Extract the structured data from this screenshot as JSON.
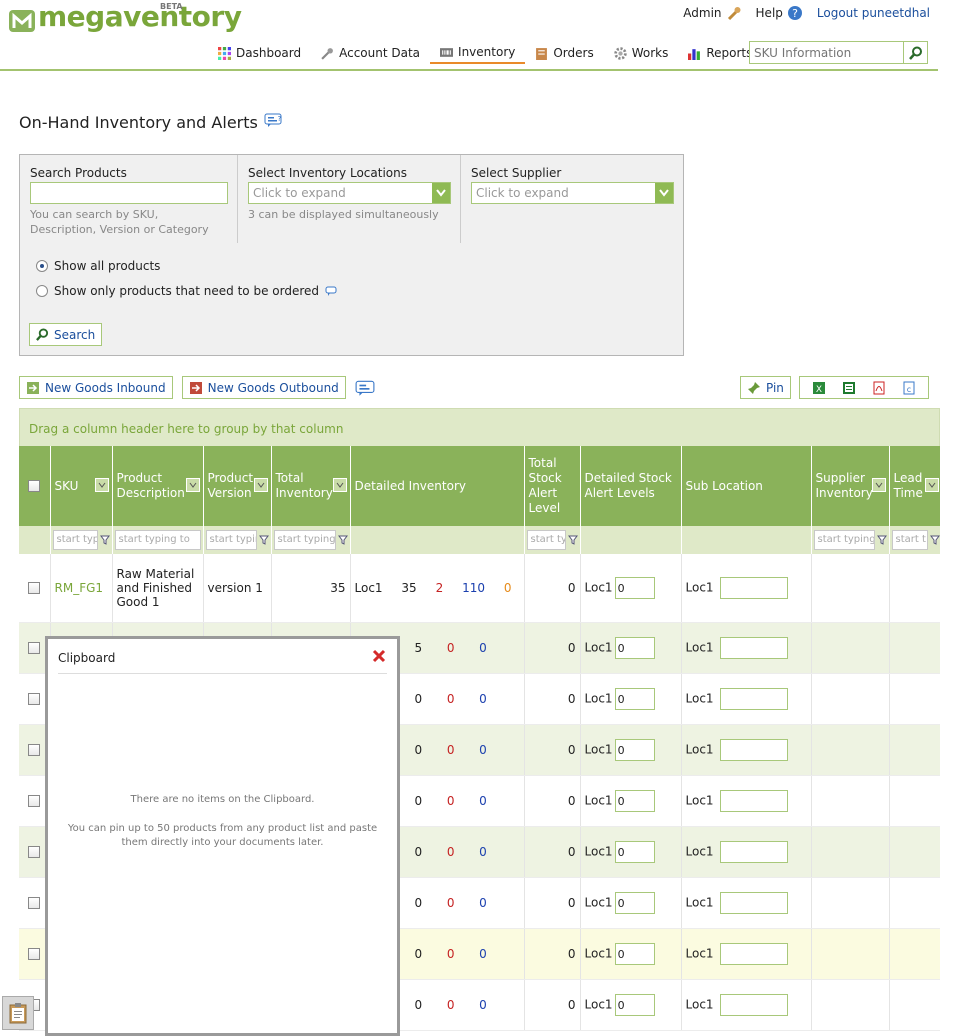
{
  "app": {
    "logo_text": "megaventory",
    "beta": "BETA",
    "user_links": {
      "admin": "Admin",
      "help": "Help",
      "logout": "Logout puneetdhal"
    },
    "nav": [
      {
        "label": "Dashboard",
        "icon": "dashboard-icon"
      },
      {
        "label": "Account Data",
        "icon": "wrench-icon"
      },
      {
        "label": "Inventory",
        "icon": "inventory-icon"
      },
      {
        "label": "Orders",
        "icon": "orders-icon"
      },
      {
        "label": "Works",
        "icon": "gear-icon"
      },
      {
        "label": "Reports",
        "icon": "chart-icon"
      }
    ],
    "sku_search_placeholder": "SKU Information",
    "accent": "#8ab25a"
  },
  "page": {
    "title": "On-Hand Inventory and Alerts"
  },
  "search_panel": {
    "products_label": "Search Products",
    "products_hint": "You can search by SKU, Description, Version or Category",
    "locations_label": "Select Inventory Locations",
    "locations_placeholder": "Click to expand",
    "locations_hint": "3 can be displayed simultaneously",
    "supplier_label": "Select Supplier",
    "supplier_placeholder": "Click to expand",
    "radio_all": "Show all products",
    "radio_need": "Show only products that need to be ordered",
    "search_button": "Search"
  },
  "toolbar": {
    "new_inbound": "New Goods Inbound",
    "new_outbound": "New Goods Outbound",
    "pin": "Pin"
  },
  "grid": {
    "group_hint": "Drag a column header here to group by that column",
    "headers": {
      "sku": "SKU",
      "desc": "Product Description",
      "version": "Product Version",
      "total": "Total Inventory",
      "detailed": "Detailed Inventory",
      "alert": "Total Stock Alert Level",
      "detailed_alert": "Detailed Stock Alert Levels",
      "sub": "Sub Location",
      "supplier": "Supplier Inventory",
      "lead": "Lead Time"
    },
    "filters": {
      "sku": "start typ",
      "desc": "start typing to",
      "version": "start typin",
      "total": "start typing",
      "alert": "start ty",
      "supplier": "start typing",
      "lead": "start t"
    },
    "rows": [
      {
        "sku": "RM_FG1",
        "desc": "Raw Material and Finished Good 1",
        "version": "version 1",
        "total": "35",
        "loc": "Loc1",
        "qty": "35",
        "a": "2",
        "b": "110",
        "c": "0",
        "alert": "0",
        "dloc": "Loc1",
        "dval": "0",
        "sloc": "Loc1"
      },
      {
        "qty": "5",
        "a": "0",
        "b": "0",
        "alert": "0",
        "dloc": "Loc1",
        "dval": "0",
        "sloc": "Loc1"
      },
      {
        "qty": "0",
        "a": "0",
        "b": "0",
        "alert": "0",
        "dloc": "Loc1",
        "dval": "0",
        "sloc": "Loc1"
      },
      {
        "qty": "0",
        "a": "0",
        "b": "0",
        "alert": "0",
        "dloc": "Loc1",
        "dval": "0",
        "sloc": "Loc1"
      },
      {
        "qty": "0",
        "a": "0",
        "b": "0",
        "alert": "0",
        "dloc": "Loc1",
        "dval": "0",
        "sloc": "Loc1"
      },
      {
        "qty": "0",
        "a": "0",
        "b": "0",
        "alert": "0",
        "dloc": "Loc1",
        "dval": "0",
        "sloc": "Loc1"
      },
      {
        "qty": "0",
        "a": "0",
        "b": "0",
        "alert": "0",
        "dloc": "Loc1",
        "dval": "0",
        "sloc": "Loc1"
      },
      {
        "qty": "0",
        "a": "0",
        "b": "0",
        "alert": "0",
        "dloc": "Loc1",
        "dval": "0",
        "sloc": "Loc1"
      },
      {
        "qty": "0",
        "a": "0",
        "b": "0",
        "alert": "0",
        "dloc": "Loc1",
        "dval": "0",
        "sloc": "Loc1"
      }
    ]
  },
  "clipboard": {
    "title": "Clipboard",
    "empty": "There are no items on the Clipboard.",
    "info": "You can pin up to 50 products from any product list and paste them directly into your documents later."
  }
}
